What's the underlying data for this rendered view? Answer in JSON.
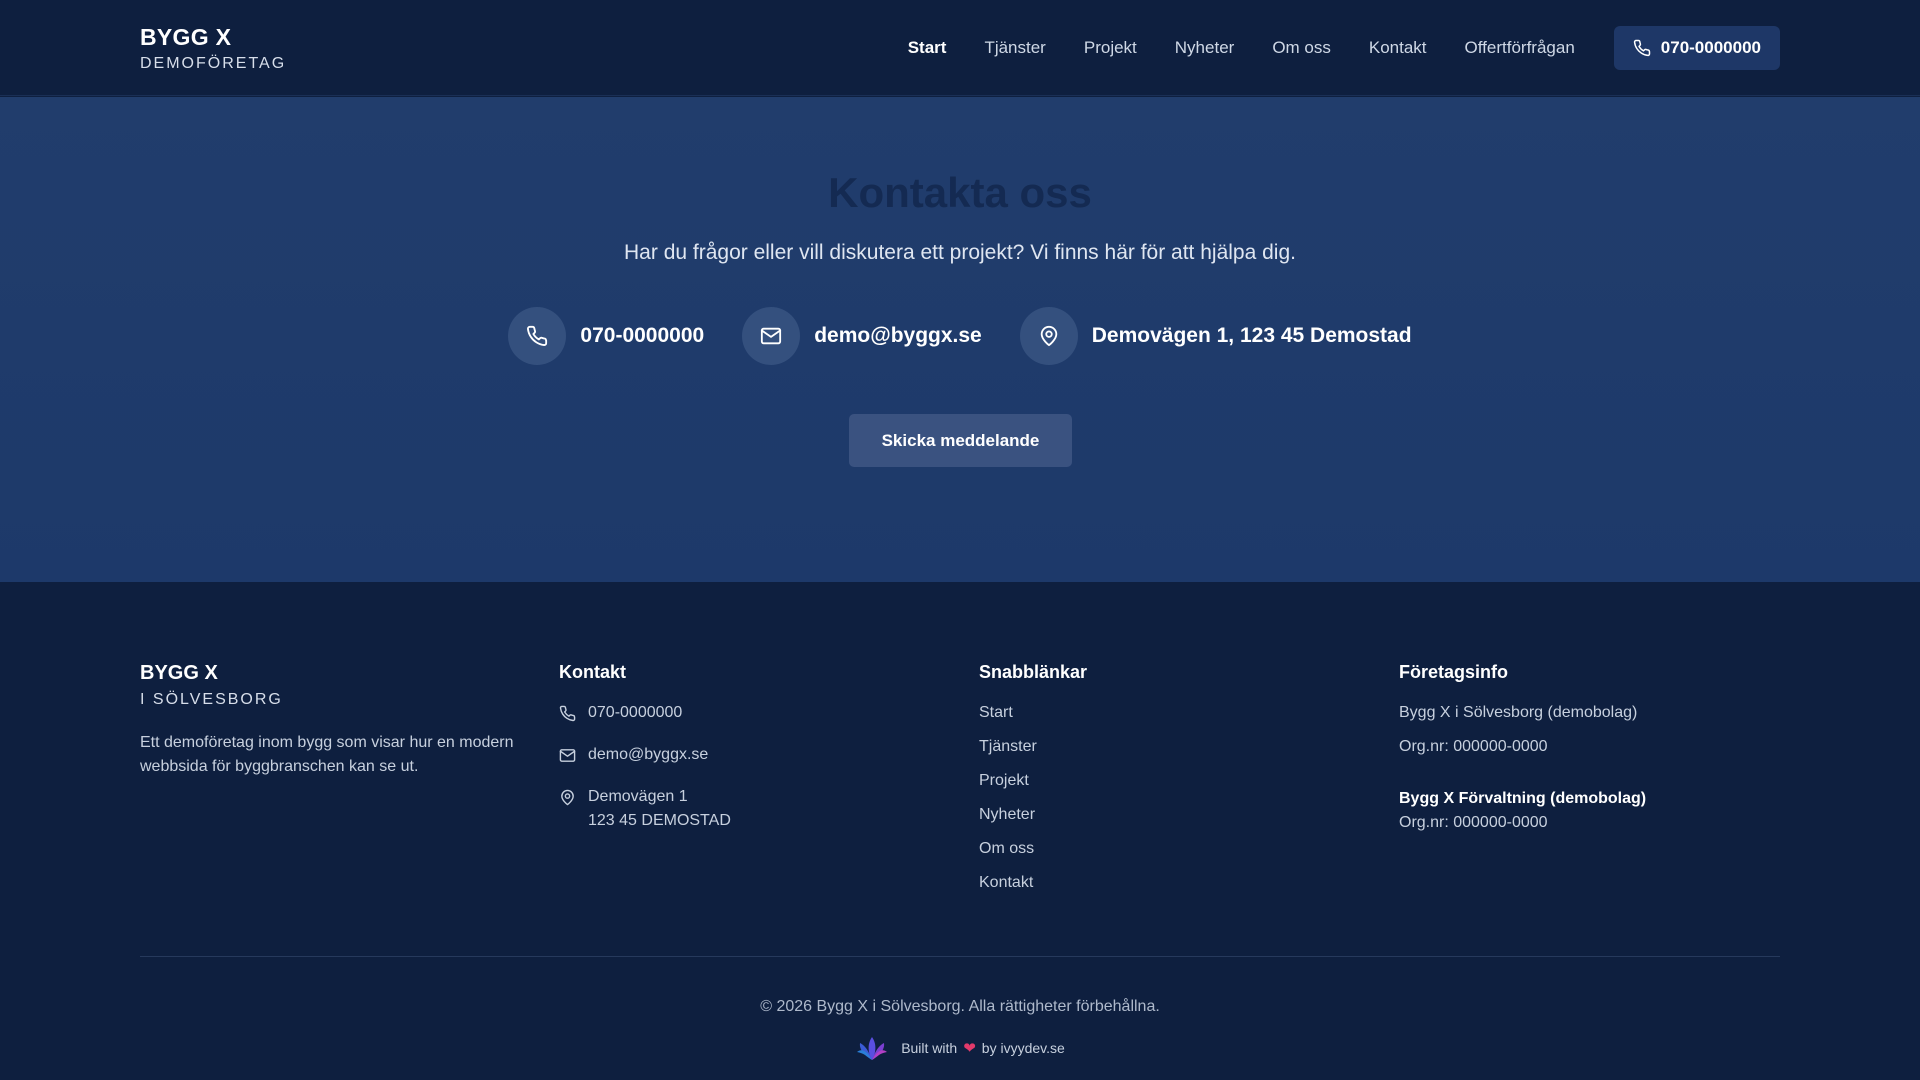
{
  "header": {
    "brand_title": "BYGG X",
    "brand_sub": "DEMOFÖRETAG",
    "nav": [
      "Start",
      "Tjänster",
      "Projekt",
      "Nyheter",
      "Om oss",
      "Kontakt",
      "Offertförfrågan"
    ],
    "active": "Start",
    "phone": "070-0000000"
  },
  "hero": {
    "title": "Kontakta oss",
    "subtitle": "Har du frågor eller vill diskutera ett projekt? Vi finns här för att hjälpa dig.",
    "phone": "070-0000000",
    "email": "demo@byggx.se",
    "address": "Demovägen 1, 123 45 Demostad",
    "cta": "Skicka meddelande"
  },
  "footer": {
    "brand_title": "BYGG X",
    "brand_sub": "I SÖLVESBORG",
    "description": "Ett demoföretag inom bygg som visar hur en modern webbsida för byggbranschen kan se ut.",
    "contact_heading": "Kontakt",
    "phone": "070-0000000",
    "email": "demo@byggx.se",
    "address_line1": "Demovägen 1",
    "address_line2": "123 45 DEMOSTAD",
    "links_heading": "Snabblänkar",
    "links": [
      "Start",
      "Tjänster",
      "Projekt",
      "Nyheter",
      "Om oss",
      "Kontakt"
    ],
    "info_heading": "Företagsinfo",
    "company1_name": "Bygg X i Sölvesborg (demobolag)",
    "company1_org": "Org.nr: 000000-0000",
    "company2_name": "Bygg X Förvaltning (demobolag)",
    "company2_org": "Org.nr: 000000-0000",
    "copyright": "© 2026 Bygg X i Sölvesborg. Alla rättigheter förbehållna.",
    "built_prefix": "Built with",
    "built_suffix": "by ivyydev.se"
  },
  "colors": {
    "header_bg": "#0e1f3f",
    "hero_bg": "#213d6c",
    "hero_title": "#142a52",
    "accent_button": "#1e3767",
    "heart": "#e23a6b"
  },
  "icons": [
    "phone-icon",
    "mail-icon",
    "map-pin-icon",
    "heart-icon",
    "ivyydev-logo-icon"
  ]
}
